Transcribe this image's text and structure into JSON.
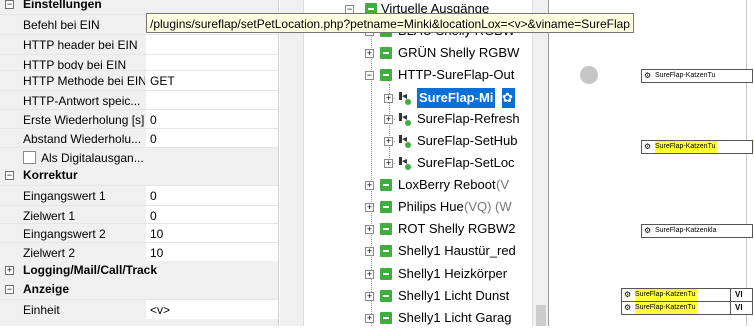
{
  "props": {
    "rows": [
      {
        "type": "section",
        "label": "Einstellungen",
        "expanded": true
      },
      {
        "type": "row",
        "key": "Befehl bei EIN",
        "value": ""
      },
      {
        "type": "row",
        "key": "HTTP header bei EIN",
        "value": ""
      },
      {
        "type": "row",
        "key": "HTTP body bei EIN",
        "value": ""
      },
      {
        "type": "row",
        "key": "HTTP Methode bei EIN",
        "value": "GET"
      },
      {
        "type": "row",
        "key": "HTTP-Antwort speic...",
        "value": ""
      },
      {
        "type": "row",
        "key": "Erste Wiederholung [s]",
        "value": "0"
      },
      {
        "type": "row",
        "key": "Abstand Wiederholu...",
        "value": "0"
      },
      {
        "type": "check",
        "key": "Als Digitalausgan...",
        "value": ""
      },
      {
        "type": "section",
        "label": "Korrektur",
        "expanded": true
      },
      {
        "type": "row",
        "key": "Eingangswert 1",
        "value": "0"
      },
      {
        "type": "row",
        "key": "Zielwert 1",
        "value": "0"
      },
      {
        "type": "row",
        "key": "Eingangswert 2",
        "value": "10"
      },
      {
        "type": "row",
        "key": "Zielwert 2",
        "value": "10"
      },
      {
        "type": "section",
        "label": "Logging/Mail/Call/Track",
        "expanded": false
      },
      {
        "type": "section",
        "label": "Anzeige",
        "expanded": true
      },
      {
        "type": "row",
        "key": "Einheit",
        "value": "<v>"
      }
    ]
  },
  "tooltip": "/plugins/sureflap/setPetLocation.php?petname=Minki&locationLox=<v>&viname=SureFlap",
  "tree": {
    "root": {
      "label": "Virtuelle Ausgänge"
    },
    "items": [
      {
        "label": "BLAU Shelly RGBW",
        "muted": ""
      },
      {
        "label": "GRÜN Shelly RGBW",
        "muted": ""
      },
      {
        "label": "HTTP-SureFlap-Out",
        "muted": "",
        "expanded": true
      },
      {
        "label": "SureFlap-Mi",
        "child": true,
        "selected": true
      },
      {
        "label": "SureFlap-Refresh",
        "child": true
      },
      {
        "label": "SureFlap-SetHub",
        "child": true
      },
      {
        "label": "SureFlap-SetLoc",
        "child": true
      },
      {
        "label": "LoxBerry Reboot",
        "muted": "(V"
      },
      {
        "label": "Philips Hue",
        "muted": "(VQ) (W"
      },
      {
        "label": "ROT Shelly RGBW2",
        "muted": ""
      },
      {
        "label": "Shelly1 Haustür_red",
        "muted": ""
      },
      {
        "label": "Shelly1 Heizkörper",
        "muted": ""
      },
      {
        "label": "Shelly1 Licht Dunst",
        "muted": ""
      },
      {
        "label": "Shelly1 Licht Garag",
        "muted": ""
      }
    ]
  },
  "canvas": {
    "blocks": [
      {
        "label": "SureFlap-KatzenTu",
        "yellow": false,
        "vi": ""
      },
      {
        "label": "SureFlap-KatzenTu",
        "yellow": true,
        "vi": ""
      },
      {
        "label": "SureFlap-Katzenkla",
        "yellow": false,
        "vi": ""
      },
      {
        "label": "SureFlap-KatzenTu",
        "yellow": true,
        "vi": "VI"
      },
      {
        "label": "SureFlap-KatzenTu",
        "yellow": true,
        "vi": "VI"
      }
    ]
  },
  "colors": {
    "selection": "#0a6fd6",
    "highlight": "#ffff33",
    "tree_icon": "#3fae3f",
    "tooltip_bg": "#ffffe1"
  }
}
